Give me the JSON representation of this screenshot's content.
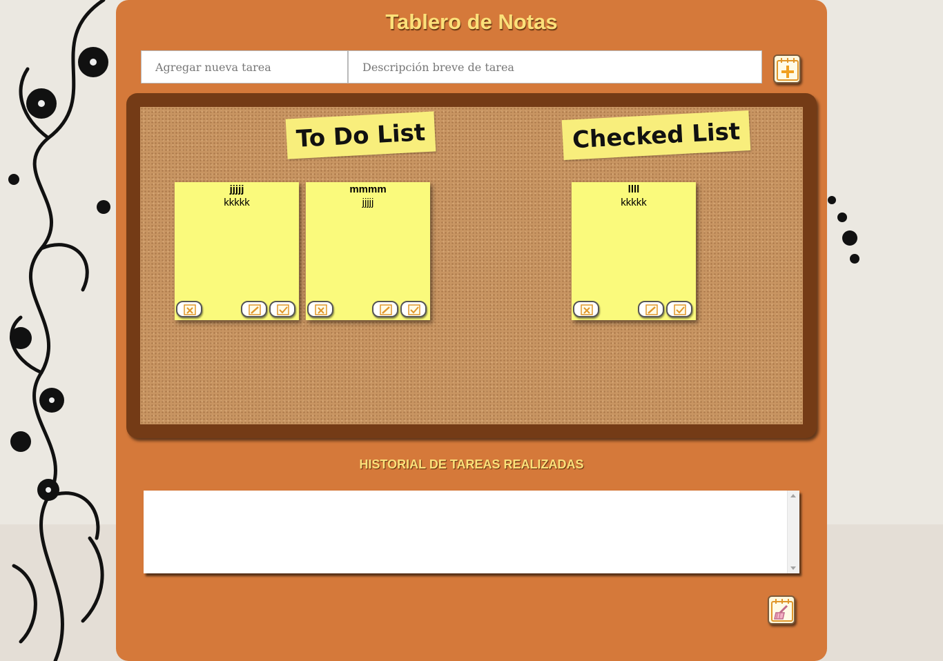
{
  "header": {
    "title": "Tablero de Notas"
  },
  "form": {
    "task_placeholder": "Agregar nueva tarea",
    "description_placeholder": "Descripción breve de tarea",
    "add_icon": "calendar-plus-icon"
  },
  "board": {
    "todo_label": "To Do List",
    "checked_label": "Checked List",
    "todo_notes": [
      {
        "title": "jjjjj",
        "description": "kkkkk"
      },
      {
        "title": "mmmm",
        "description": "jjjjj"
      }
    ],
    "checked_notes": [
      {
        "title": "llll",
        "description": "kkkkk"
      }
    ],
    "note_icons": [
      "delete-calendar-icon",
      "edit-calendar-icon",
      "check-calendar-icon"
    ]
  },
  "history": {
    "title": "HISTORIAL DE TAREAS REALIZADAS",
    "content": "",
    "clear_icon": "calendar-broom-icon"
  },
  "colors": {
    "panel": "#d5793a",
    "board_frame": "#743b16",
    "cork": "#c89562",
    "note": "#fafa7c",
    "title_text": "#fbe07a"
  }
}
